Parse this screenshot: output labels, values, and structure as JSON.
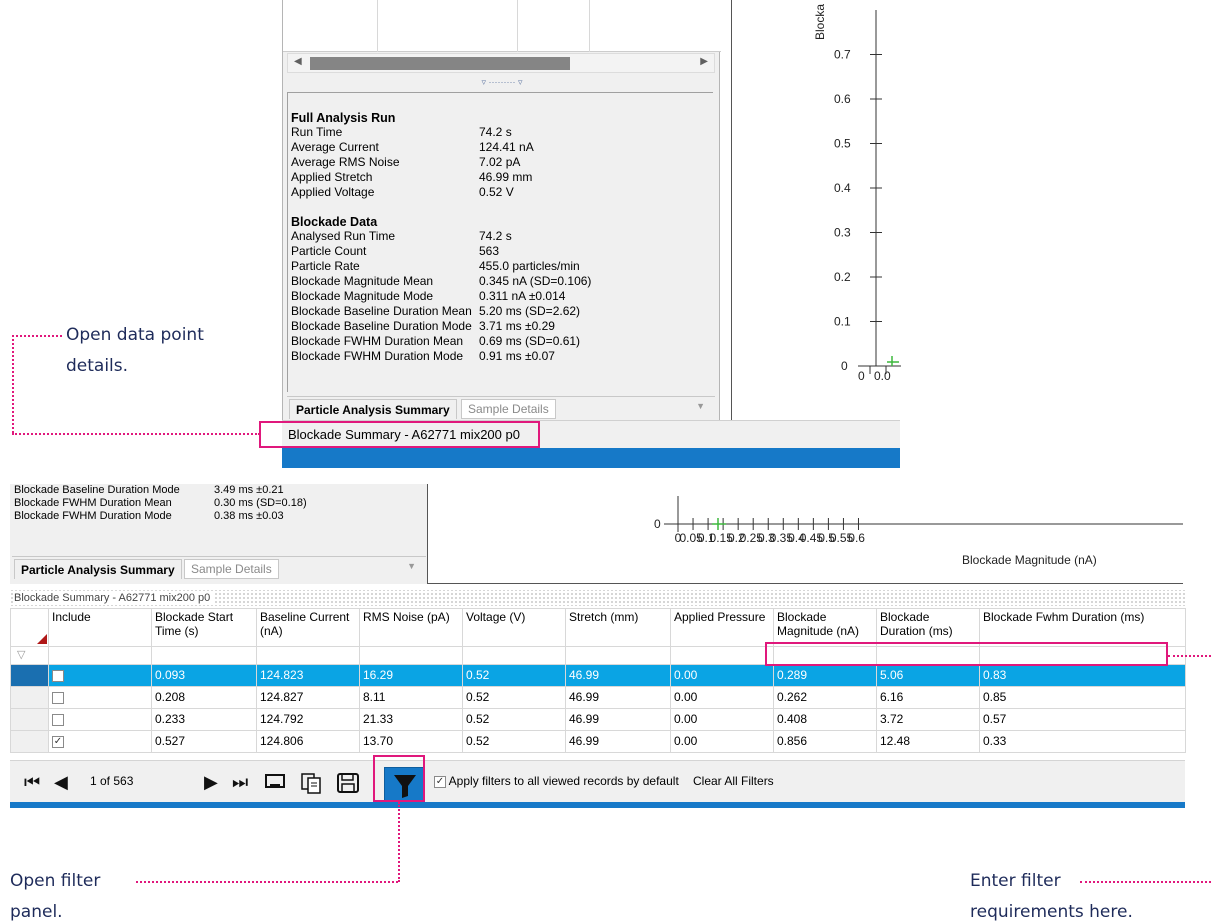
{
  "callouts": {
    "open_details": "Open data point",
    "open_details_2": "details.",
    "open_filter": "Open filter",
    "open_filter_2": "panel.",
    "enter_filter": "Enter filter",
    "enter_filter_2": "requirements here."
  },
  "top_panel": {
    "splitter_glyph": "▿ ········· ▿",
    "sections": [
      {
        "title": "Full Analysis Run",
        "rows": [
          {
            "k": "Run Time",
            "v": "74.2 s"
          },
          {
            "k": "Average Current",
            "v": "124.41 nA"
          },
          {
            "k": "Average RMS Noise",
            "v": "7.02 pA"
          },
          {
            "k": "Applied Stretch",
            "v": "46.99 mm"
          },
          {
            "k": "Applied Voltage",
            "v": "0.52 V"
          }
        ]
      },
      {
        "title": "Blockade Data",
        "rows": [
          {
            "k": "Analysed Run Time",
            "v": "74.2 s"
          },
          {
            "k": "Particle Count",
            "v": "563"
          },
          {
            "k": "Particle Rate",
            "v": "455.0 particles/min"
          },
          {
            "k": "Blockade Magnitude Mean",
            "v": "0.345 nA (SD=0.106)"
          },
          {
            "k": "Blockade Magnitude Mode",
            "v": "0.311 nA ±0.014"
          },
          {
            "k": "Blockade Baseline Duration Mean",
            "v": "5.20 ms (SD=2.62)"
          },
          {
            "k": "Blockade Baseline Duration Mode",
            "v": "3.71 ms ±0.29"
          },
          {
            "k": "Blockade FWHM Duration Mean",
            "v": "0.69 ms (SD=0.61)"
          },
          {
            "k": "Blockade FWHM Duration Mode",
            "v": "0.91 ms ±0.07"
          }
        ]
      }
    ],
    "tab_active": "Particle Analysis Summary",
    "tab_inactive": "Sample Details",
    "status": "Blockade Summary - A62771 mix200 p0",
    "chart_ylabel": "Blocka",
    "chart_xtick_partial": "0.0"
  },
  "bottom_panel": {
    "summary_rows": [
      {
        "k": "Blockade Baseline Duration Mode",
        "v": "3.49 ms ±0.21"
      },
      {
        "k": "Blockade FWHM Duration Mean",
        "v": "0.30 ms (SD=0.18)"
      },
      {
        "k": "Blockade FWHM Duration Mode",
        "v": "0.38 ms ±0.03"
      }
    ],
    "tab_active": "Particle Analysis Summary",
    "tab_inactive": "Sample Details",
    "chart_xlabel": "Blockade Magnitude (nA)",
    "grid_title": "Blockade Summary - A62771 mix200 p0",
    "columns": [
      "Include",
      "Blockade Start Time (s)",
      "Baseline Current (nA)",
      "RMS Noise (pA)",
      "Voltage (V)",
      "Stretch (mm)",
      "Applied Pressure",
      "Blockade Magnitude (nA)",
      "Blockade Duration (ms)",
      "Blockade Fwhm Duration (ms)"
    ],
    "rows": [
      {
        "include": false,
        "cells": [
          "0.093",
          "124.823",
          "16.29",
          "0.52",
          "46.99",
          "0.00",
          "0.289",
          "5.06",
          "0.83"
        ],
        "selected": true
      },
      {
        "include": false,
        "cells": [
          "0.208",
          "124.827",
          "8.11",
          "0.52",
          "46.99",
          "0.00",
          "0.262",
          "6.16",
          "0.85"
        ],
        "selected": false
      },
      {
        "include": false,
        "cells": [
          "0.233",
          "124.792",
          "21.33",
          "0.52",
          "46.99",
          "0.00",
          "0.408",
          "3.72",
          "0.57"
        ],
        "selected": false
      },
      {
        "include": true,
        "cells": [
          "0.527",
          "124.806",
          "13.70",
          "0.52",
          "46.99",
          "0.00",
          "0.856",
          "12.48",
          "0.33"
        ],
        "selected": false
      }
    ],
    "pager": "1 of 563",
    "apply_filters_label": "Apply filters to all viewed records by default",
    "clear_filters_label": "Clear All Filters"
  },
  "chart_data": [
    {
      "type": "scatter",
      "y_ticks": [
        "0.7",
        "0.6",
        "0.5",
        "0.4",
        "0.3",
        "0.2",
        "0.1",
        "0"
      ],
      "x_ticks": [
        "0",
        "0.0"
      ],
      "ylabel": "Blocka"
    },
    {
      "type": "scatter",
      "y_ticks": [
        "0"
      ],
      "x_ticks": [
        "0",
        "0.05",
        "0.1",
        "0.15",
        "0.2",
        "0.25",
        "0.3",
        "0.35",
        "0.4",
        "0.45",
        "0.5",
        "0.55",
        "0.6"
      ],
      "xlabel": "Blockade Magnitude (nA)"
    }
  ],
  "colors": {
    "accent": "#1679c8",
    "selection": "#0aa4e4",
    "callout": "#e0187c"
  }
}
